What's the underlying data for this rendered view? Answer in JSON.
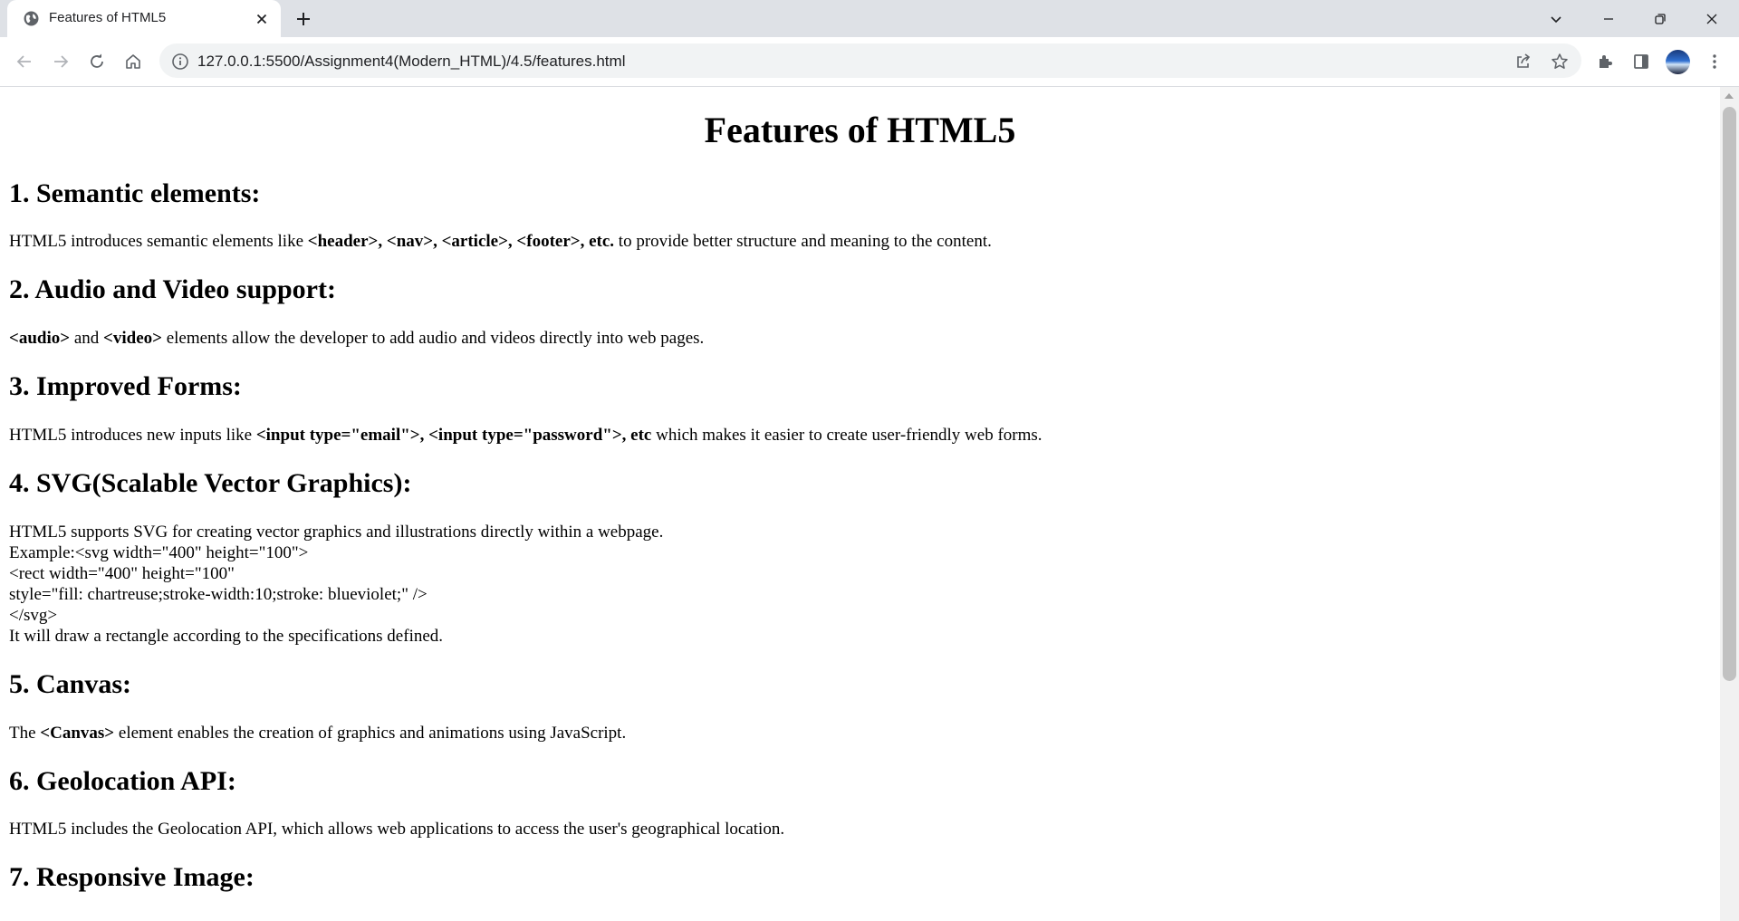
{
  "browser": {
    "tab_title": "Features of HTML5",
    "url": "127.0.0.1:5500/Assignment4(Modern_HTML)/4.5/features.html",
    "icons": [
      "globe-icon",
      "close-icon",
      "plus-icon",
      "chevron-down-icon",
      "minimize-icon",
      "restore-icon",
      "close-window-icon",
      "back-icon",
      "forward-icon",
      "reload-icon",
      "home-icon",
      "info-icon",
      "share-icon",
      "star-icon",
      "puzzle-icon",
      "side-panel-icon",
      "avatar",
      "kebab-menu-icon"
    ]
  },
  "page": {
    "title": "Features of HTML5",
    "s1": {
      "heading": "1. Semantic elements:",
      "t1": "HTML5 introduces semantic elements like ",
      "b1": "<header>, <nav>, <article>, <footer>, etc.",
      "t2": " to provide better structure and meaning to the content."
    },
    "s2": {
      "heading": "2. Audio and Video support:",
      "b1": "<audio>",
      "t1": " and ",
      "b2": "<video>",
      "t2": " elements allow the developer to add audio and videos directly into web pages."
    },
    "s3": {
      "heading": "3. Improved Forms:",
      "t1": "HTML5 introduces new inputs like ",
      "b1": "<input type=\"email\">, <input type=\"password\">, etc",
      "t2": " which makes it easier to create user-friendly web forms."
    },
    "s4": {
      "heading": "4. SVG(Scalable Vector Graphics):",
      "lines": [
        "HTML5 supports SVG for creating vector graphics and illustrations directly within a webpage.",
        "Example:<svg width=\"400\" height=\"100\">",
        "<rect width=\"400\" height=\"100\"",
        "style=\"fill: chartreuse;stroke-width:10;stroke: blueviolet;\" />",
        "</svg>",
        "It will draw a rectangle according to the specifications defined."
      ]
    },
    "s5": {
      "heading": "5. Canvas:",
      "t1": "The ",
      "b1": "<Canvas>",
      "t2": " element enables the creation of graphics and animations using JavaScript."
    },
    "s6": {
      "heading": "6. Geolocation API:",
      "t1": "HTML5 includes the Geolocation API, which allows web applications to access the user's geographical location."
    },
    "s7": {
      "heading": "7. Responsive Image:"
    }
  }
}
